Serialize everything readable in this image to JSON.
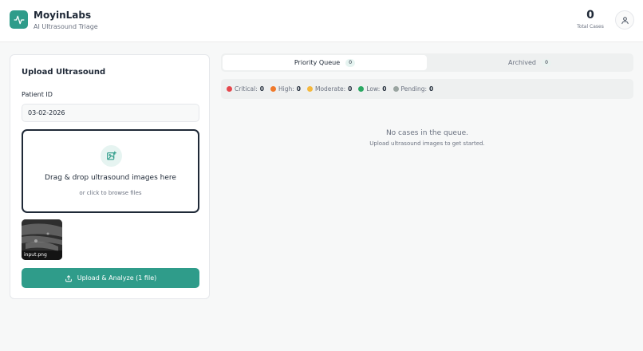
{
  "header": {
    "brand_name": "MoyinLabs",
    "brand_sub": "AI Ultrasound Triage",
    "total_count": "0",
    "total_label": "Total Cases",
    "icons": {
      "logo": "activity-icon",
      "avatar": "user-icon"
    }
  },
  "upload": {
    "title": "Upload Ultrasound",
    "patient_id_label": "Patient ID",
    "patient_id_value": "03-02-2026",
    "dropzone_title": "Drag & drop ultrasound images here",
    "dropzone_sub": "or click to browse files",
    "dropzone_icon": "image-plus-icon",
    "files": [
      {
        "name": "input.png"
      }
    ],
    "button_label": "Upload & Analyze (1 file)",
    "button_icon": "upload-icon"
  },
  "tabs": [
    {
      "label": "Priority Queue",
      "count": "0",
      "active": true
    },
    {
      "label": "Archived",
      "count": "0",
      "active": false
    }
  ],
  "stats": [
    {
      "label": "Critical:",
      "value": "0",
      "color": "#e5484d"
    },
    {
      "label": "High:",
      "value": "0",
      "color": "#f07a2b"
    },
    {
      "label": "Moderate:",
      "value": "0",
      "color": "#f5b83d"
    },
    {
      "label": "Low:",
      "value": "0",
      "color": "#2aa862"
    },
    {
      "label": "Pending:",
      "value": "0",
      "color": "#9aa5a1"
    }
  ],
  "empty": {
    "title": "No cases in the queue.",
    "sub": "Upload ultrasound images to get started."
  },
  "colors": {
    "accent": "#2f9c8a",
    "accent_light": "#e6f4f1"
  }
}
